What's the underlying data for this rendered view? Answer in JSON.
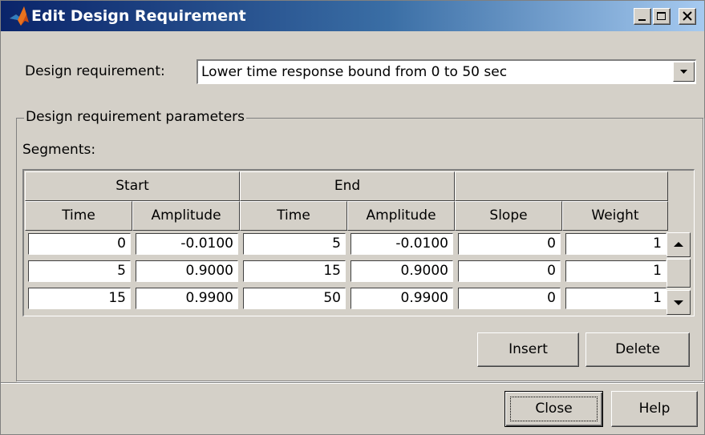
{
  "window": {
    "title": "Edit Design Requirement",
    "icon": "matlab-icon",
    "controls": {
      "minimize": "minimize-icon",
      "maximize": "maximize-icon",
      "close": "close-icon"
    }
  },
  "requirement": {
    "label": "Design requirement:",
    "selected": "Lower time response bound from 0 to 50 sec"
  },
  "parameters": {
    "legend": "Design requirement parameters",
    "segments_label": "Segments:",
    "group_headers": [
      "Start",
      "End",
      ""
    ],
    "columns": [
      "Time",
      "Amplitude",
      "Time",
      "Amplitude",
      "Slope",
      "Weight"
    ],
    "rows": [
      [
        "0",
        "-0.0100",
        "5",
        "-0.0100",
        "0",
        "1"
      ],
      [
        "5",
        "0.9000",
        "15",
        "0.9000",
        "0",
        "1"
      ],
      [
        "15",
        "0.9900",
        "50",
        "0.9900",
        "0",
        "1"
      ]
    ],
    "insert_label": "Insert",
    "delete_label": "Delete"
  },
  "footer": {
    "close_label": "Close",
    "help_label": "Help"
  },
  "colors": {
    "title_gradient_start": "#0a246a",
    "title_gradient_end": "#a6caf0",
    "face": "#d4d0c8"
  }
}
